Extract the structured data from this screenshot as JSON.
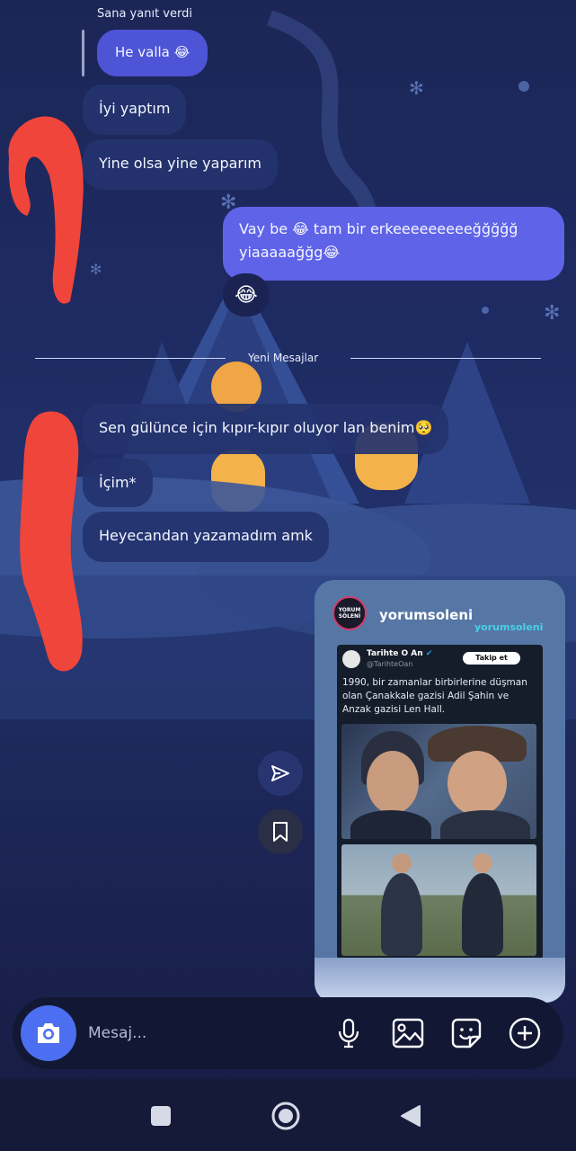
{
  "reply_header": "Sana yanıt verdi",
  "messages_top": {
    "replied": "He valla 😂",
    "m1": "İyi yaptım",
    "m2": "Yine olsa yine yaparım"
  },
  "my_message": {
    "line1": "Vay be 😂 tam bir erkeeeeeeeeeğğğğğ",
    "line2": "yiaaaaağğg😂",
    "reaction": "😂"
  },
  "divider_label": "Yeni Mesajlar",
  "messages_new": {
    "m1": "Sen gülünce için kıpır-kıpır oluyor lan benim🥺",
    "m2": "İçim*",
    "m3": "Heyecandan  yazamadım amk"
  },
  "shared_post": {
    "username": "yorumsoleni",
    "watermark": "yorumsoleni",
    "avatar_text": "YORUM SÖLENİ",
    "tweet": {
      "name": "Tarihte O An",
      "handle": "@TarihteOan",
      "follow_label": "Takip et",
      "text": "1990, bir zamanlar birbirlerine düşman olan Çanakkale gazisi Adil Şahin ve Anzak gazisi Len Hall."
    }
  },
  "composer": {
    "placeholder": "Mesaj..."
  },
  "colors": {
    "bubble": "#24336e",
    "my_bubble": "#5f63e8",
    "accent": "#4c6ef0",
    "scribble": "#f0453a"
  }
}
